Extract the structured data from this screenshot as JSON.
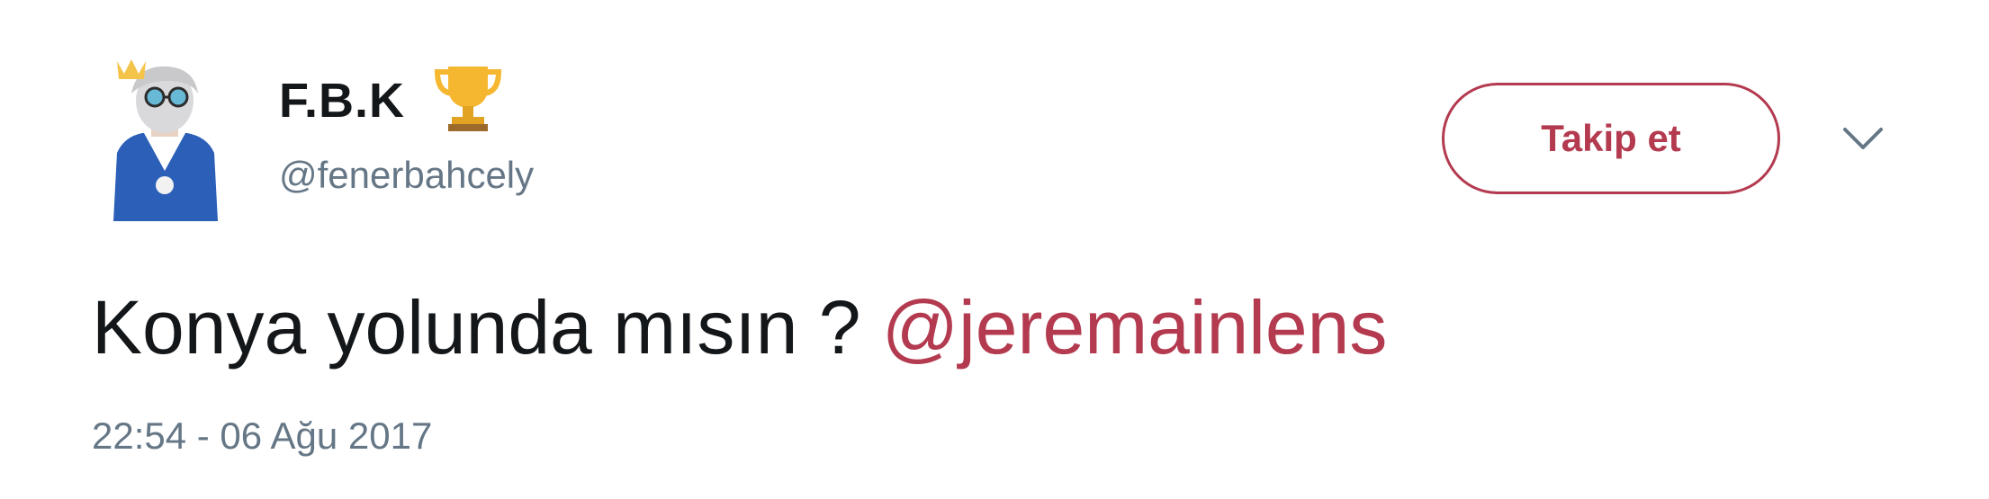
{
  "user": {
    "display_name": "F.B.K",
    "handle": "@fenerbahcely",
    "badge_icon": "trophy-icon",
    "avatar_icon": "avatar-icon"
  },
  "actions": {
    "follow_label": "Takip et",
    "menu_icon": "chevron-down-icon"
  },
  "tweet": {
    "text": "Konya yolunda mısın ? ",
    "mention": "@jeremainlens",
    "timestamp": "22:54 - 06 Ağu 2017"
  },
  "colors": {
    "accent": "#b33a4f",
    "text": "#14171a",
    "secondary": "#657786"
  }
}
